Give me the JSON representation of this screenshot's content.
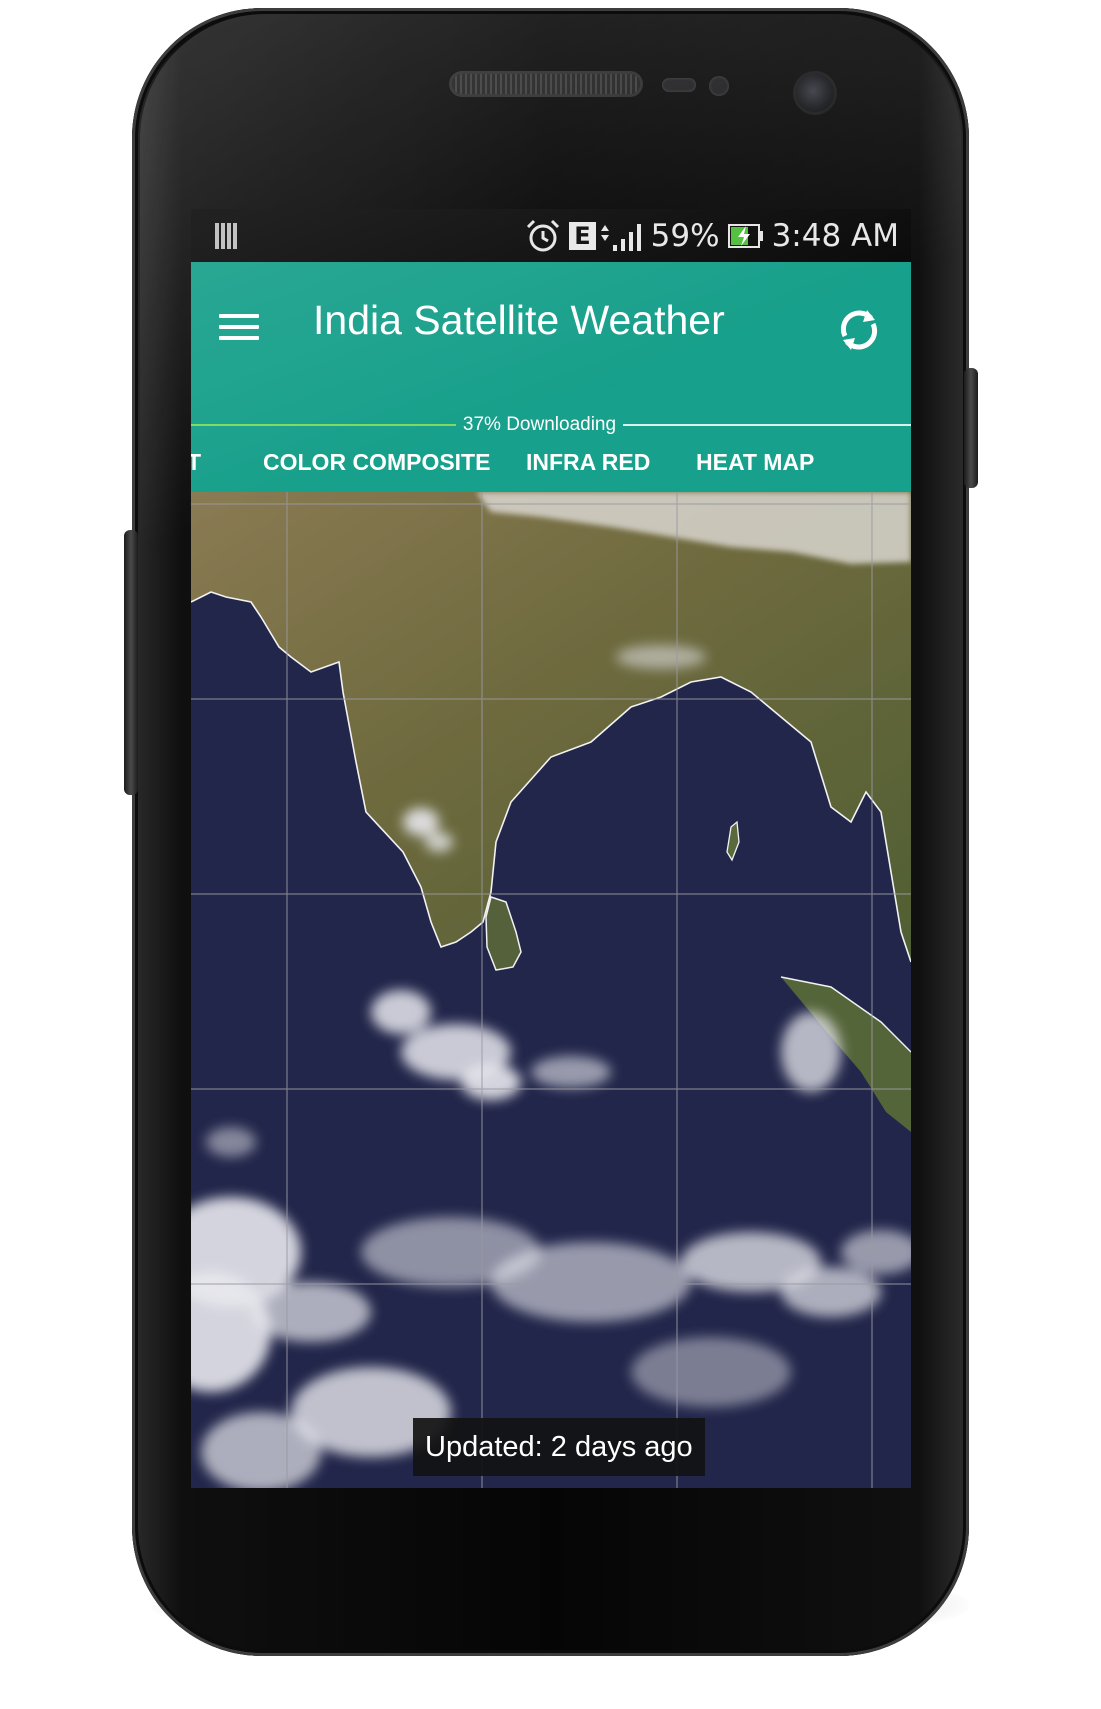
{
  "status_bar": {
    "battery_percent": "59%",
    "network_type": "E",
    "time": "3:48 AM"
  },
  "app_bar": {
    "title": "India Satellite Weather",
    "progress": {
      "label": "37% Downloading",
      "fraction": 0.37
    },
    "tabs": [
      {
        "label": "T",
        "selected": false
      },
      {
        "label": "COLOR COMPOSITE",
        "selected": true
      },
      {
        "label": "INFRA RED",
        "selected": false
      },
      {
        "label": "HEAT MAP",
        "selected": false
      }
    ]
  },
  "map": {
    "updated_label": "Updated: 2 days ago"
  },
  "colors": {
    "app_bar": "#17a08b",
    "progress_done": "#7ddb5e",
    "ocean": "#1e2244",
    "land": "#6b6a3e"
  },
  "icons": [
    "notification-icon",
    "alarm-icon",
    "signal-icon",
    "battery-charging-icon",
    "menu-icon",
    "refresh-icon"
  ]
}
